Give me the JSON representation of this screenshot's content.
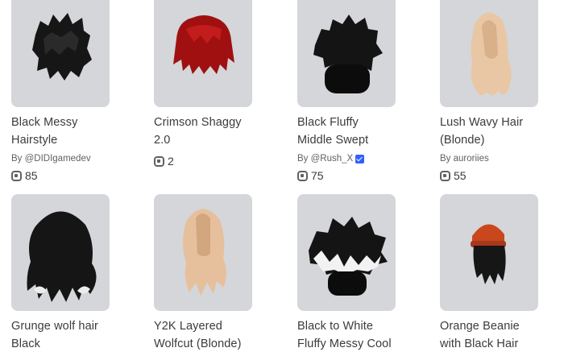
{
  "items": [
    {
      "name_line1": "Black Messy",
      "name_line2": "Hairstyle",
      "creator": "By @DIDIgamedev",
      "verified": false,
      "price": "85",
      "icon": "black-messy-hair-thumbnail"
    },
    {
      "name_line1": "Crimson Shaggy",
      "name_line2": "2.0",
      "creator": "",
      "verified": false,
      "price": "2",
      "icon": "crimson-shaggy-hair-thumbnail"
    },
    {
      "name_line1": "Black Fluffy",
      "name_line2": "Middle Swept",
      "creator": "By @Rush_X",
      "verified": true,
      "price": "75",
      "icon": "black-fluffy-hair-thumbnail"
    },
    {
      "name_line1": "Lush Wavy Hair",
      "name_line2": "(Blonde)",
      "creator": "By auroriies",
      "verified": false,
      "price": "55",
      "icon": "blonde-wavy-hair-thumbnail"
    },
    {
      "name_line1": "Grunge wolf hair",
      "name_line2": "Black",
      "creator": "",
      "verified": false,
      "price": "",
      "icon": "grunge-wolf-hair-thumbnail"
    },
    {
      "name_line1": "Y2K Layered",
      "name_line2": "Wolfcut (Blonde)",
      "creator": "",
      "verified": false,
      "price": "",
      "icon": "blonde-wolfcut-hair-thumbnail"
    },
    {
      "name_line1": "Black to White",
      "name_line2": "Fluffy Messy Cool",
      "creator": "",
      "verified": false,
      "price": "",
      "icon": "black-white-fluffy-hair-thumbnail"
    },
    {
      "name_line1": "Orange Beanie",
      "name_line2": "with Black Hair",
      "creator": "",
      "verified": false,
      "price": "",
      "icon": "orange-beanie-hair-thumbnail"
    }
  ],
  "colors": {
    "thumb_bg": "#d4d6d9",
    "text": "#393b3d",
    "subtext": "#606162",
    "verified": "#335fff",
    "black_hair": "#1a1a1a",
    "crimson_hair": "#a01010",
    "blonde_hair": "#e9c7a4",
    "orange_beanie": "#c9471c"
  }
}
